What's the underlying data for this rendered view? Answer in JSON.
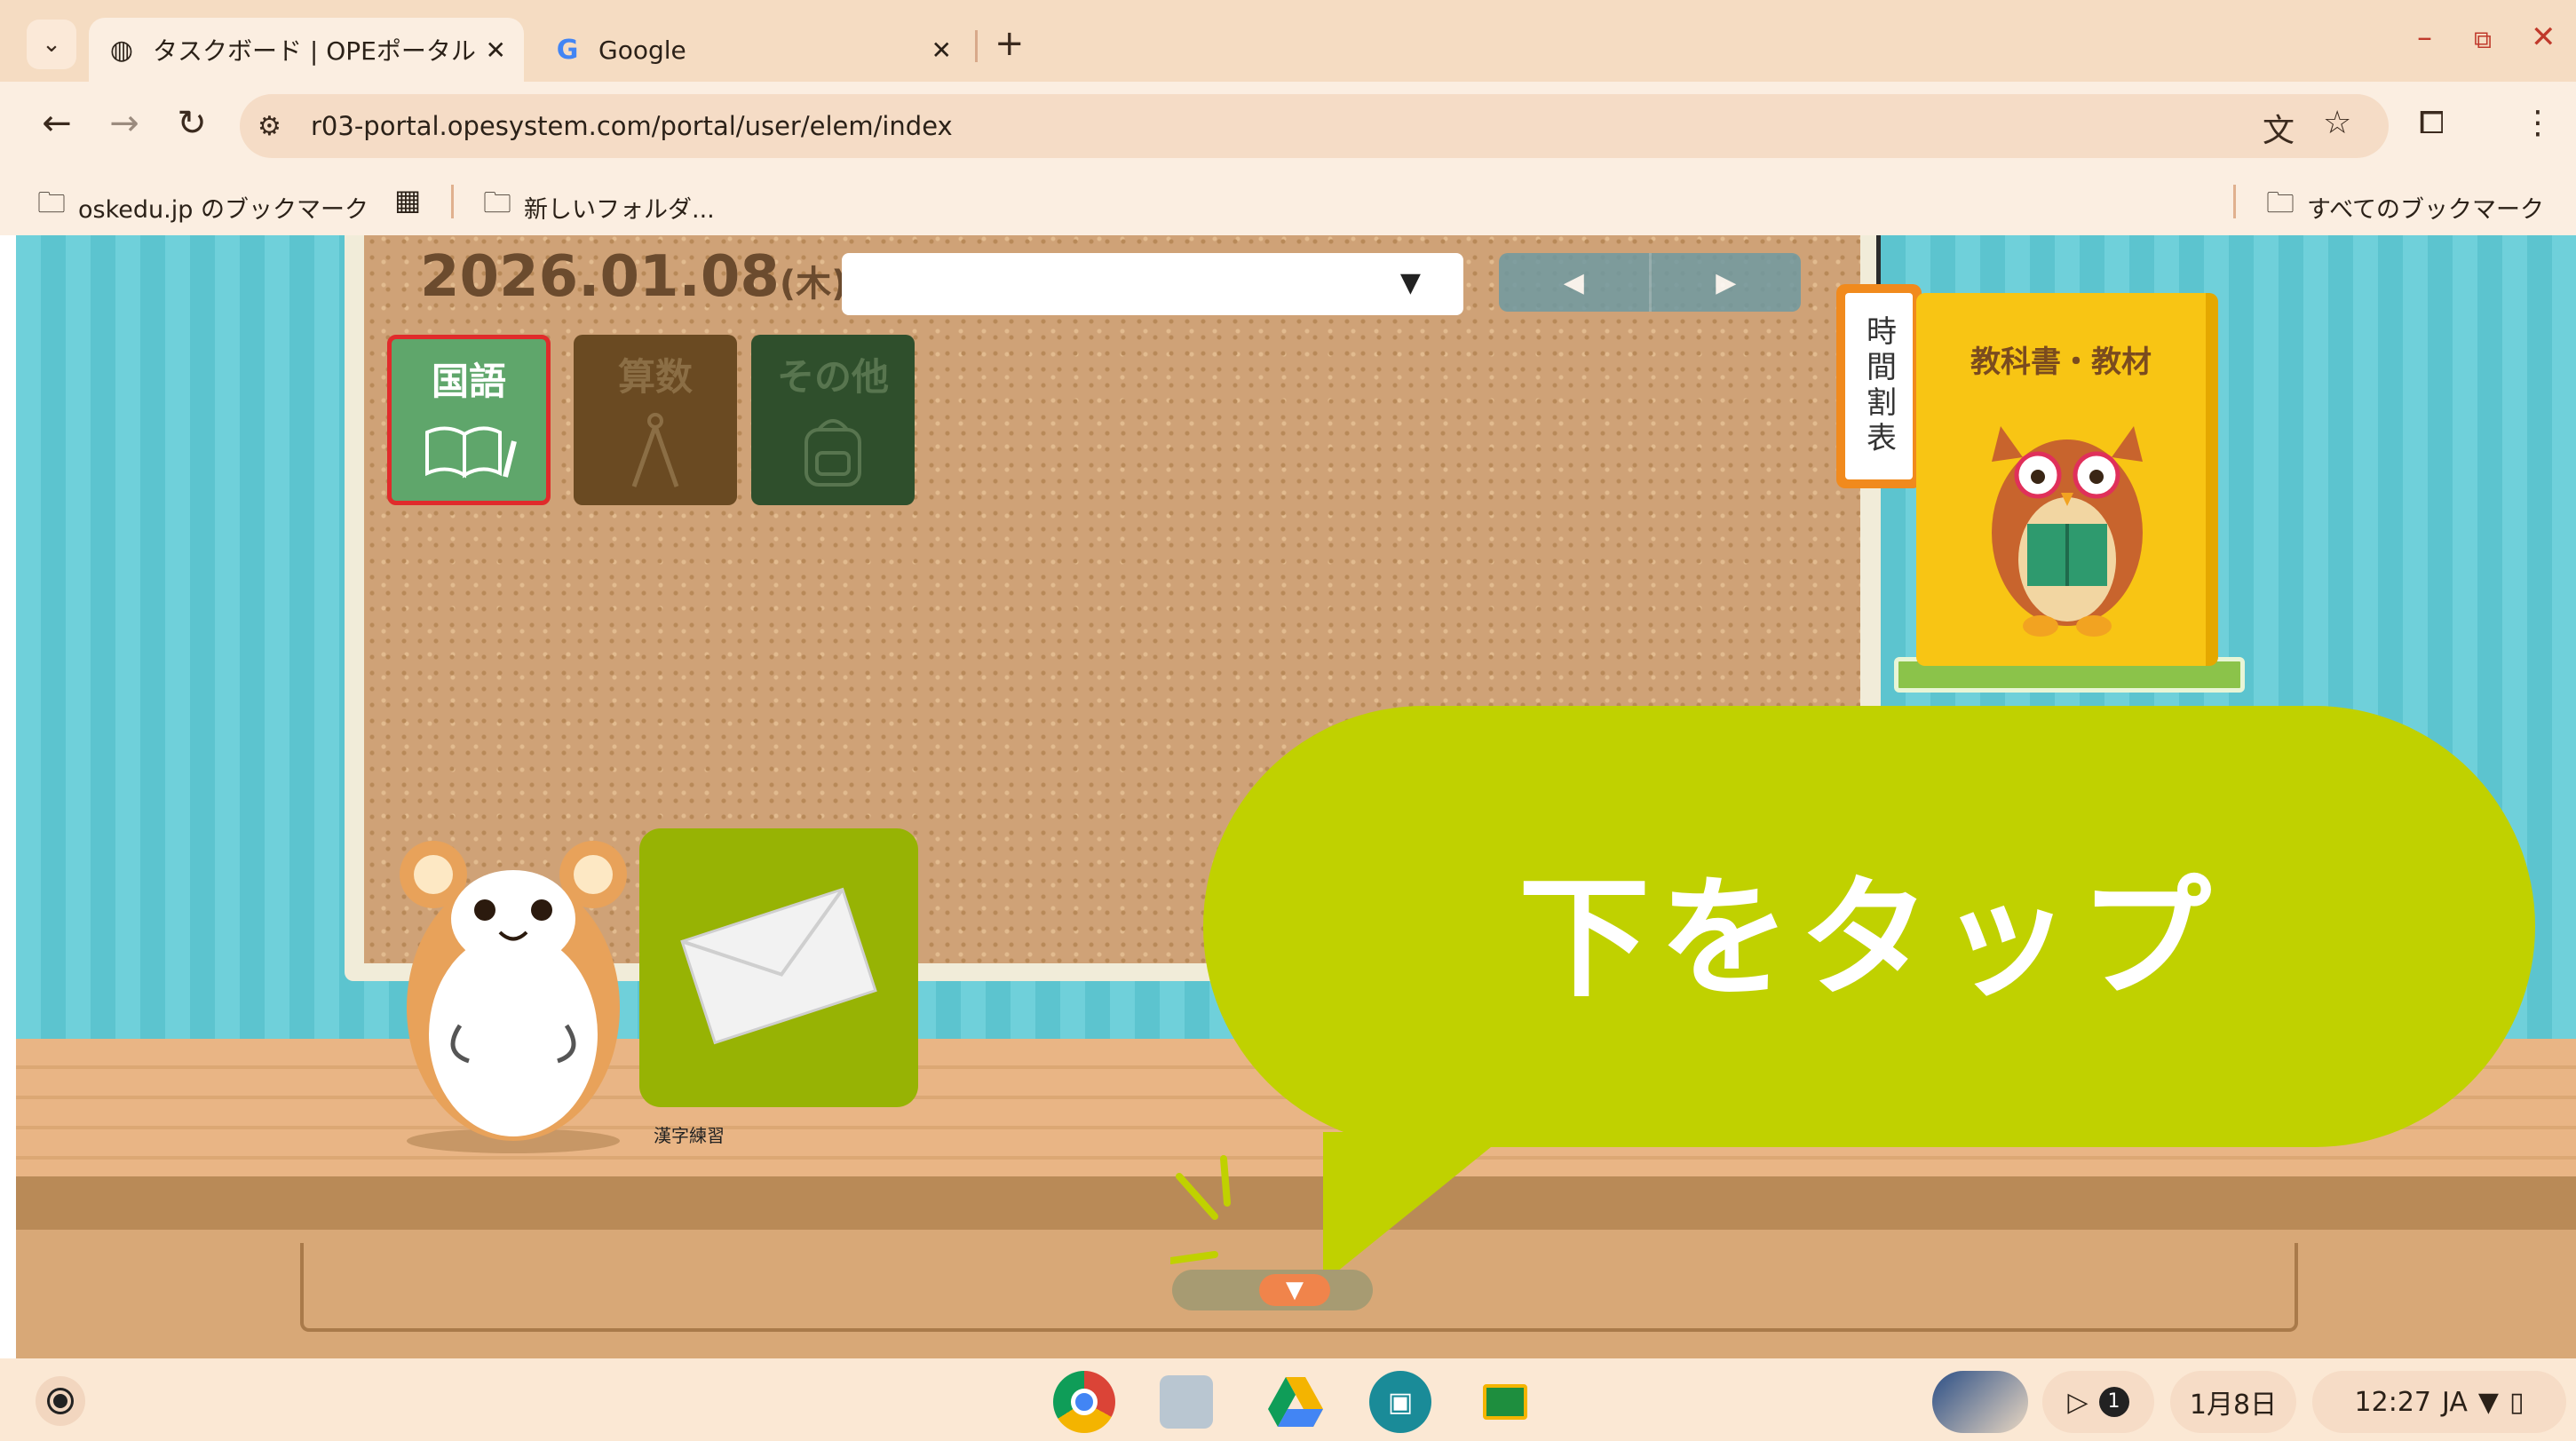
{
  "browser": {
    "tabs": [
      {
        "title": "タスクボード | OPEポータル",
        "active": true
      },
      {
        "title": "Google",
        "active": false
      }
    ],
    "url": "r03-portal.opesystem.com/portal/user/elem/index",
    "bookmarks": {
      "left": [
        {
          "label": "oskedu.jp のブックマーク"
        },
        {
          "label": "新しいフォルダ..."
        }
      ],
      "right": {
        "label": "すべてのブックマーク"
      }
    }
  },
  "page": {
    "date": "2026.01.08",
    "weekday": "(木)",
    "class_select_value": "",
    "subjects": [
      {
        "label": "国語",
        "icon": "book-pencil-icon",
        "selected": true
      },
      {
        "label": "算数",
        "icon": "compass-icon",
        "selected": false
      },
      {
        "label": "その他",
        "icon": "backpack-icon",
        "selected": false
      }
    ],
    "timetable_tag": "時間割表",
    "textbook_title": "教科書・教材",
    "tasks": [
      {
        "label": "漢字練習",
        "icon": "envelope-icon"
      }
    ],
    "bubble_text": "下をタップ",
    "colors": {
      "wall": "#6fd0da",
      "bubble": "#c0d100",
      "selected_border": "#e02b2b",
      "kokugo_tile": "#5fa66b",
      "task_tile": "#97b304"
    }
  },
  "shelf": {
    "date": "1月8日",
    "time": "12:27",
    "ime": "JA",
    "notification_count": "1",
    "apps": [
      "chrome-icon",
      "files-icon",
      "drive-icon",
      "meet-icon",
      "classroom-icon"
    ]
  }
}
